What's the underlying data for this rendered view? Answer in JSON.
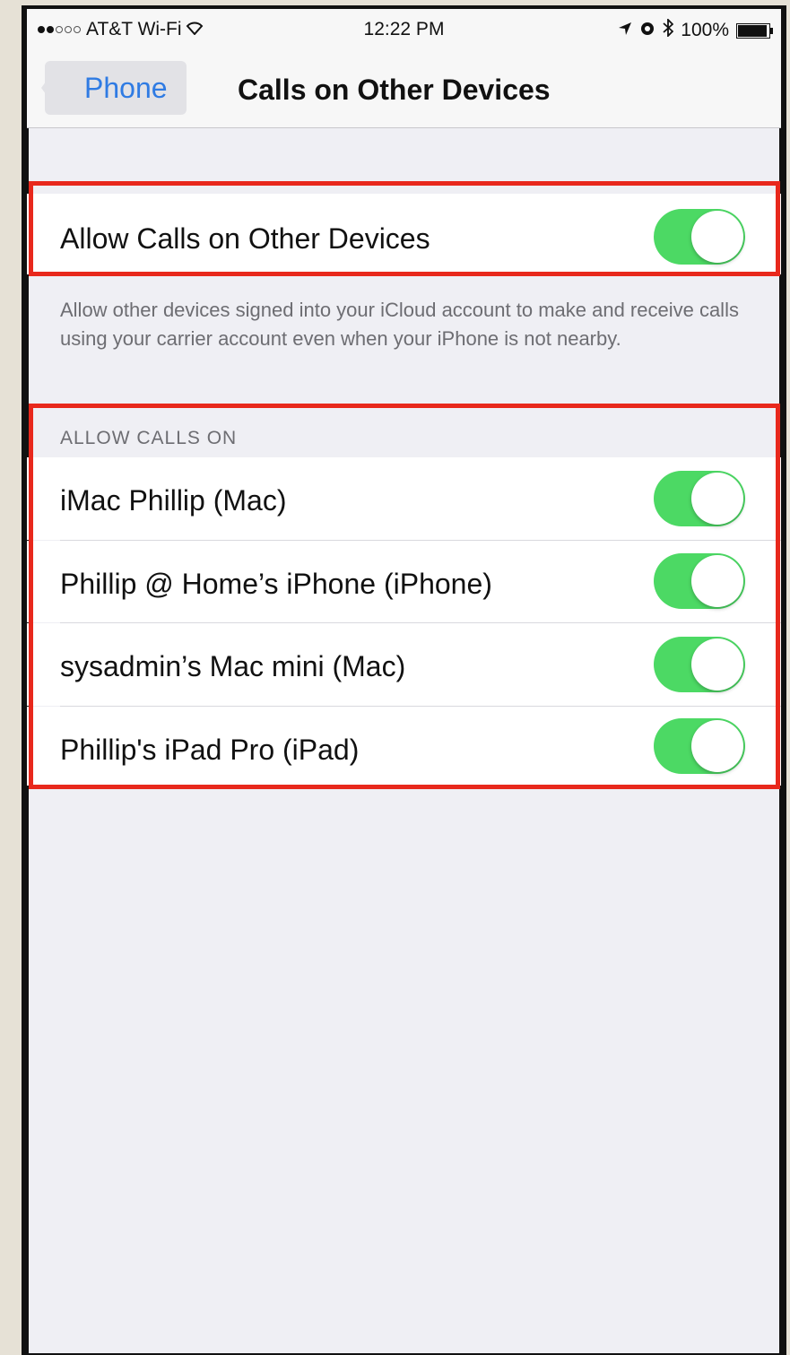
{
  "status_bar": {
    "carrier": "AT&T Wi-Fi",
    "time": "12:22 PM",
    "battery": "100%",
    "battery_level": 1.0,
    "signal_bars": 2
  },
  "nav": {
    "back_label": "Phone",
    "title": "Calls on Other Devices"
  },
  "main_toggle": {
    "label": "Allow Calls on Other Devices",
    "on": true
  },
  "description": "Allow other devices signed into your iCloud account to make and receive calls using your carrier account even when your iPhone is not nearby.",
  "section_header": "ALLOW CALLS ON",
  "devices": [
    {
      "label": "iMac Phillip (Mac)",
      "on": true
    },
    {
      "label": "Phillip @ Home’s iPhone (iPhone)",
      "on": true
    },
    {
      "label": "sysadmin’s Mac mini (Mac)",
      "on": true
    },
    {
      "label": "Phillip's iPad Pro (iPad)",
      "on": true
    }
  ],
  "colors": {
    "toggle_on": "#4cd964",
    "accent": "#2f7be3",
    "highlight": "#e8281c"
  },
  "icons": [
    "wifi-icon",
    "location-icon",
    "alarm-icon",
    "bluetooth-icon",
    "battery-icon",
    "back-chevron-icon"
  ]
}
